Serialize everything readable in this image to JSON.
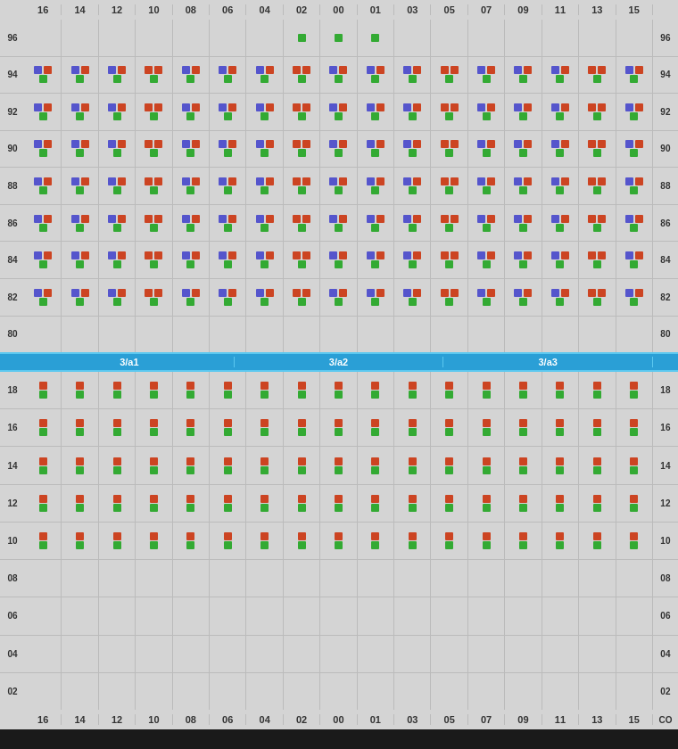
{
  "colors": {
    "blue": "#5555cc",
    "red": "#cc4422",
    "green": "#33aa33",
    "accent": "#2a9fd6"
  },
  "col_headers": [
    "16",
    "14",
    "12",
    "10",
    "08",
    "06",
    "04",
    "02",
    "00",
    "01",
    "03",
    "05",
    "07",
    "09",
    "11",
    "13",
    "15"
  ],
  "top_rows": [
    {
      "label": "96",
      "special": true
    },
    {
      "label": "94"
    },
    {
      "label": "92"
    },
    {
      "label": "90"
    },
    {
      "label": "88"
    },
    {
      "label": "86"
    },
    {
      "label": "84"
    },
    {
      "label": "82"
    },
    {
      "label": "80",
      "empty": true
    }
  ],
  "zones": [
    "3/a1",
    "3/a2",
    "3/a3"
  ],
  "bottom_rows": [
    {
      "label": "18"
    },
    {
      "label": "16"
    },
    {
      "label": "14"
    },
    {
      "label": "12"
    },
    {
      "label": "10"
    },
    {
      "label": "08",
      "empty": true
    },
    {
      "label": "06",
      "empty": true
    },
    {
      "label": "04",
      "empty": true
    },
    {
      "label": "02",
      "empty": true
    }
  ],
  "bottom_col_headers": [
    "16",
    "14",
    "12",
    "10",
    "08",
    "06",
    "04",
    "02",
    "00",
    "01",
    "03",
    "05",
    "07",
    "09",
    "11",
    "13",
    "15"
  ],
  "co_label": "CO"
}
